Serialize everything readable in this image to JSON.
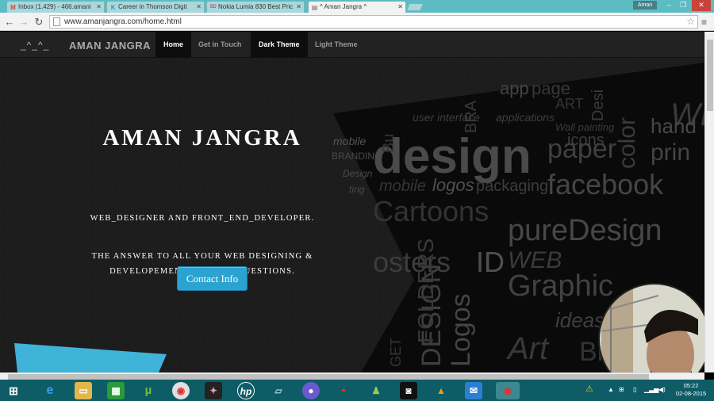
{
  "browser": {
    "tabs": [
      {
        "title": "Inbox (1,429) - 466.amani",
        "icon": "gmail-icon"
      },
      {
        "title": "Career in Thomson Digit",
        "icon": "thomson-icon"
      },
      {
        "title": "Nokia Lumia 830 Best Pric",
        "icon": "snapdeal-icon"
      },
      {
        "title": "^ Aman Jangra ^",
        "icon": "page-icon"
      }
    ],
    "user": "Aman",
    "url": "www.amanjangra.com/home.html"
  },
  "site": {
    "brand_emote": "_^_^_",
    "brand": "AMAN JANGRA",
    "nav": [
      "Home",
      "Get in Touch",
      "Dark Theme",
      "Light Theme"
    ],
    "hero": {
      "title": "AMAN JANGRA",
      "line1": "WEB_DESIGNER AND FRONT_END_DEVELOPER.",
      "line2a": "THE ANSWER TO ALL YOUR WEB DESIGNING &",
      "line2b": "DEVELOPEMENT RELATED QUESTIONS.",
      "cta": "Contact Info"
    },
    "collage_words": [
      "design",
      "mobile",
      "logos",
      "packaging",
      "facebook",
      "Cartoons",
      "pureDesign",
      "WEB",
      "Graphic",
      "ideas",
      "Art",
      "icons",
      "paper",
      "print",
      "app",
      "page",
      "ART",
      "user interface",
      "applications",
      "Wall painting",
      "color",
      "DESIGN",
      "Logos",
      "FOLDERS",
      "posters",
      "ID",
      "BRANDING",
      "hand"
    ]
  },
  "taskbar": {
    "clock_time": "05:22",
    "clock_date": "02-08-2015"
  },
  "colors": {
    "accent": "#2ba3d1",
    "chrome": "#5cbcc4",
    "taskbar": "#0e5c66"
  }
}
